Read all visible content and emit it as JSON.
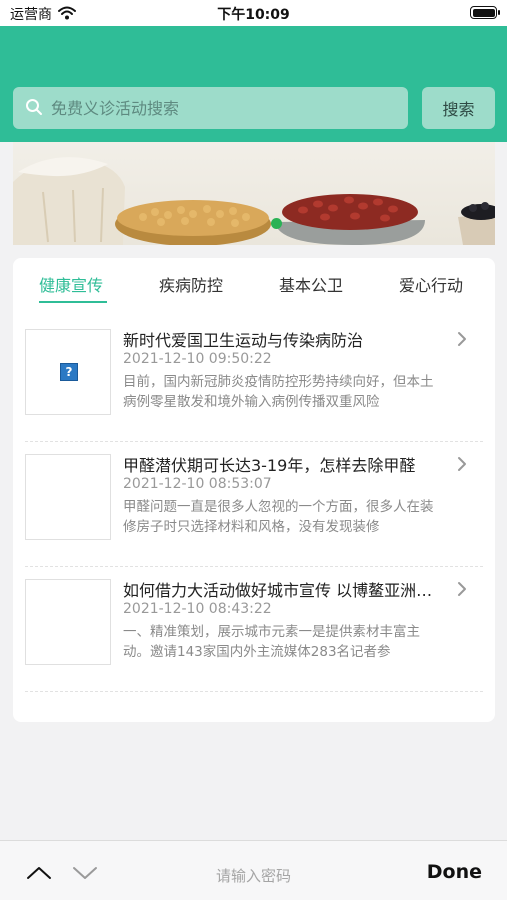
{
  "status_bar": {
    "carrier": "运营商",
    "time": "下午10:09"
  },
  "search": {
    "placeholder": "免费义诊活动搜索",
    "button_label": "搜索"
  },
  "banner": {
    "active_index": 0
  },
  "tabs": [
    {
      "label": "健康宣传",
      "active": true
    },
    {
      "label": "疾病防控",
      "active": false
    },
    {
      "label": "基本公卫",
      "active": false
    },
    {
      "label": "爱心行动",
      "active": false
    }
  ],
  "articles": [
    {
      "title": "新时代爱国卫生运动与传染病防治",
      "date": "2021-12-10 09:50:22",
      "summary": "目前，国内新冠肺炎疫情防控形势持续向好，但本土病例零星散发和境外输入病例传播双重风险",
      "thumb_broken": true
    },
    {
      "title": "甲醛潜伏期可长达3-19年，怎样去除甲醛",
      "date": "2021-12-10 08:53:07",
      "summary": "甲醛问题一直是很多人忽视的一个方面，很多人在装修房子时只选择材料和风格，没有发现装修",
      "thumb_broken": false
    },
    {
      "title": "如何借力大活动做好城市宣传 以博鳌亚洲论坛",
      "date": "2021-12-10 08:43:22",
      "summary": "一、精准策划，展示城市元素一是提供素材丰富主动。邀请143家国内外主流媒体283名记者参",
      "thumb_broken": false
    }
  ],
  "keyboard_bar": {
    "hint": "请输入密码",
    "done_label": "Done"
  },
  "colors": {
    "primary": "#2fbd97",
    "search_bg": "#9ddcca",
    "page_bg": "#f2f2f3"
  }
}
